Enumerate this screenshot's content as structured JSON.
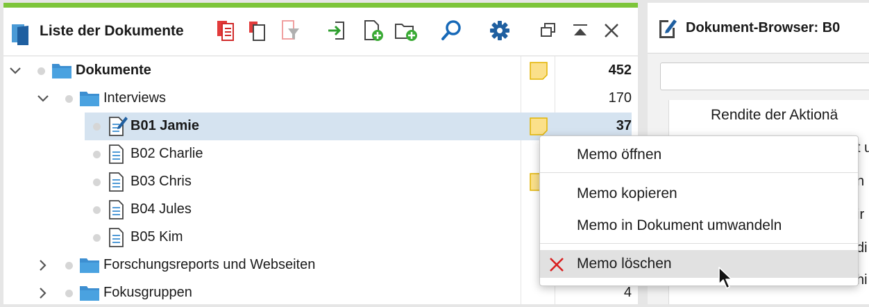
{
  "left_panel": {
    "title": "Liste der Dokumente",
    "accent_color": "#7dc53a",
    "toolbar_icons": [
      "copy-red-icon",
      "copy-list-icon",
      "filter-icon",
      "import-icon",
      "new-document-icon",
      "new-folder-icon",
      "search-icon",
      "gear-icon",
      "restore-window-icon",
      "collapse-icon",
      "close-icon"
    ],
    "tree": [
      {
        "label": "Dokumente",
        "count": "452",
        "memo": true,
        "bold": true,
        "level": 0,
        "kind": "folder",
        "chevron": "down"
      },
      {
        "label": "Interviews",
        "count": "170",
        "memo": false,
        "bold": false,
        "level": 1,
        "kind": "folder",
        "chevron": "down"
      },
      {
        "label": "B01 Jamie",
        "count": "37",
        "memo": true,
        "bold": true,
        "level": 2,
        "kind": "doc-edit",
        "selected": true
      },
      {
        "label": "B02 Charlie",
        "count": "",
        "memo": false,
        "bold": false,
        "level": 2,
        "kind": "doc"
      },
      {
        "label": "B03 Chris",
        "count": "",
        "memo": true,
        "bold": false,
        "level": 2,
        "kind": "doc"
      },
      {
        "label": "B04 Jules",
        "count": "",
        "memo": false,
        "bold": false,
        "level": 2,
        "kind": "doc"
      },
      {
        "label": "B05 Kim",
        "count": "",
        "memo": false,
        "bold": false,
        "level": 2,
        "kind": "doc"
      },
      {
        "label": "Forschungsreports und Webseiten",
        "count": "",
        "memo": false,
        "bold": false,
        "level": 1,
        "kind": "folder",
        "chevron": "right"
      },
      {
        "label": "Fokusgruppen",
        "count": "4",
        "memo": false,
        "bold": false,
        "level": 1,
        "kind": "folder",
        "chevron": "right"
      }
    ]
  },
  "right_panel": {
    "title": "Dokument-Browser: B0",
    "doc_heading": "Rendite der Aktionä",
    "text_fragments": [
      "t u",
      "n",
      "ir",
      "di",
      "hi"
    ]
  },
  "context_menu": {
    "items": [
      {
        "label": "Memo öffnen"
      },
      {
        "label": "Memo kopieren"
      },
      {
        "label": "Memo in Dokument umwandeln"
      },
      {
        "label": "Memo löschen",
        "icon": "delete-x-icon",
        "hovered": true
      }
    ]
  }
}
